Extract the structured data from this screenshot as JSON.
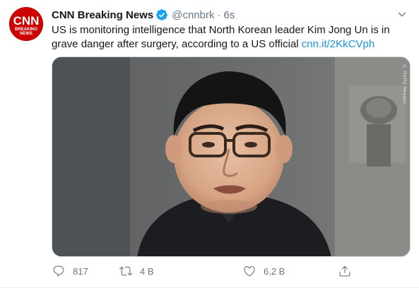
{
  "tweet": {
    "author_name": "CNN Breaking News",
    "handle": "@cnnbrk",
    "separator": "·",
    "time": "6s",
    "text": "US is monitoring intelligence that North Korean leader Kim Jong Un is in grave danger after surgery, according to a US official ",
    "link_text": "cnn.it/2KkCVph",
    "image_credit": "© Getty Images",
    "verified": true
  },
  "avatar": {
    "logo_text": "CNN",
    "sub_text_1": "BREAKING",
    "sub_text_2": "NEWS",
    "brand_color": "#cc0000"
  },
  "actions": {
    "reply_count": "817",
    "retweet_count": "4 В",
    "like_count": "6,2 В"
  },
  "icons": {
    "verified": "verified-badge-icon",
    "caret": "chevron-down-icon",
    "reply": "reply-icon",
    "retweet": "retweet-icon",
    "like": "heart-icon",
    "share": "share-icon"
  },
  "colors": {
    "link": "#1b95e0",
    "secondary_text": "#657786",
    "verified": "#1da1f2"
  }
}
